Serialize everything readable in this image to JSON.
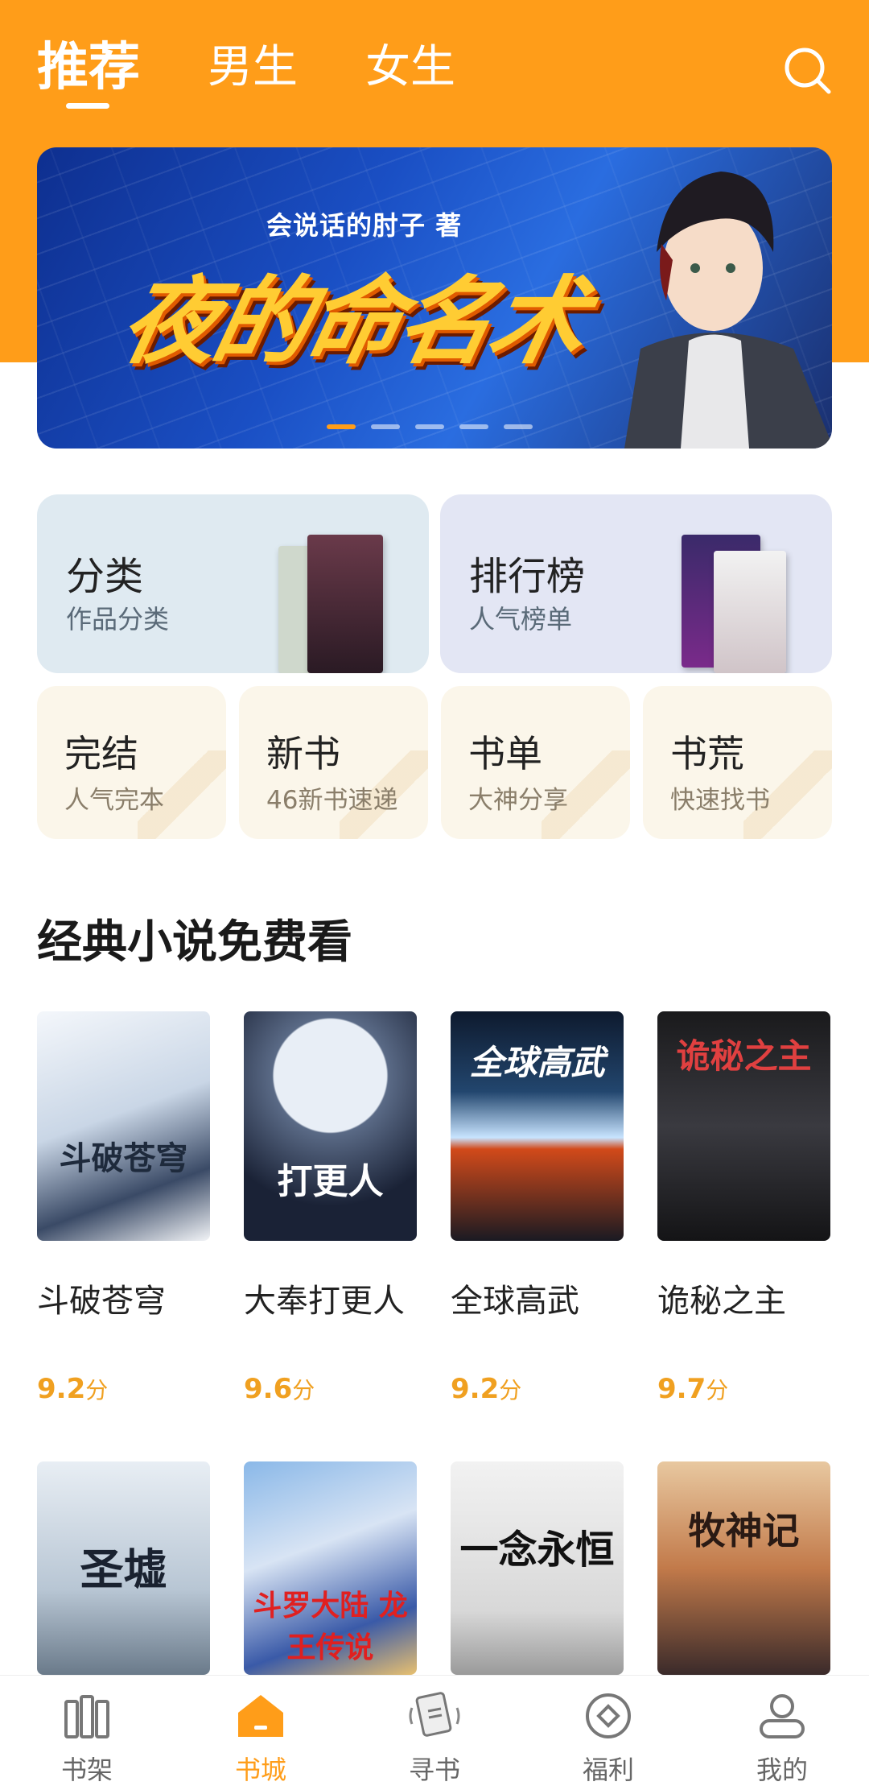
{
  "header": {
    "tabs": [
      {
        "label": "推荐",
        "active": true
      },
      {
        "label": "男生",
        "active": false
      },
      {
        "label": "女生",
        "active": false
      }
    ],
    "search_icon": "search-icon",
    "accent": "#ff9d19"
  },
  "banner": {
    "author": "会说话的肘子 著",
    "title": "夜的命名术",
    "slide_count": 5,
    "active_slide": 1
  },
  "entries": {
    "category": {
      "title": "分类",
      "subtitle": "作品分类"
    },
    "ranking": {
      "title": "排行榜",
      "subtitle": "人气榜单"
    },
    "small": [
      {
        "title": "完结",
        "subtitle": "人气完本"
      },
      {
        "title": "新书",
        "subtitle": "46新书速递"
      },
      {
        "title": "书单",
        "subtitle": "大神分享"
      },
      {
        "title": "书荒",
        "subtitle": "快速找书"
      }
    ]
  },
  "section": {
    "title": "经典小说免费看",
    "books": [
      {
        "name": "斗破苍穹",
        "score": "9.2",
        "unit": "分",
        "cover_text": "斗破苍穹"
      },
      {
        "name": "大奉打更人",
        "score": "9.6",
        "unit": "分",
        "cover_text": "打更人"
      },
      {
        "name": "全球高武",
        "score": "9.2",
        "unit": "分",
        "cover_text": "全球高武"
      },
      {
        "name": "诡秘之主",
        "score": "9.7",
        "unit": "分",
        "cover_text": "诡秘之主"
      }
    ],
    "books_row2": [
      {
        "cover_text": "圣墟"
      },
      {
        "cover_text": "斗罗大陆 龙王传说"
      },
      {
        "cover_text": "一念永恒"
      },
      {
        "cover_text": "牧神记"
      }
    ]
  },
  "nav": {
    "items": [
      {
        "label": "书架",
        "icon": "bookshelf-icon",
        "active": false
      },
      {
        "label": "书城",
        "icon": "bookstore-icon",
        "active": true
      },
      {
        "label": "寻书",
        "icon": "find-book-icon",
        "active": false
      },
      {
        "label": "福利",
        "icon": "welfare-icon",
        "active": false
      },
      {
        "label": "我的",
        "icon": "profile-icon",
        "active": false
      }
    ]
  }
}
